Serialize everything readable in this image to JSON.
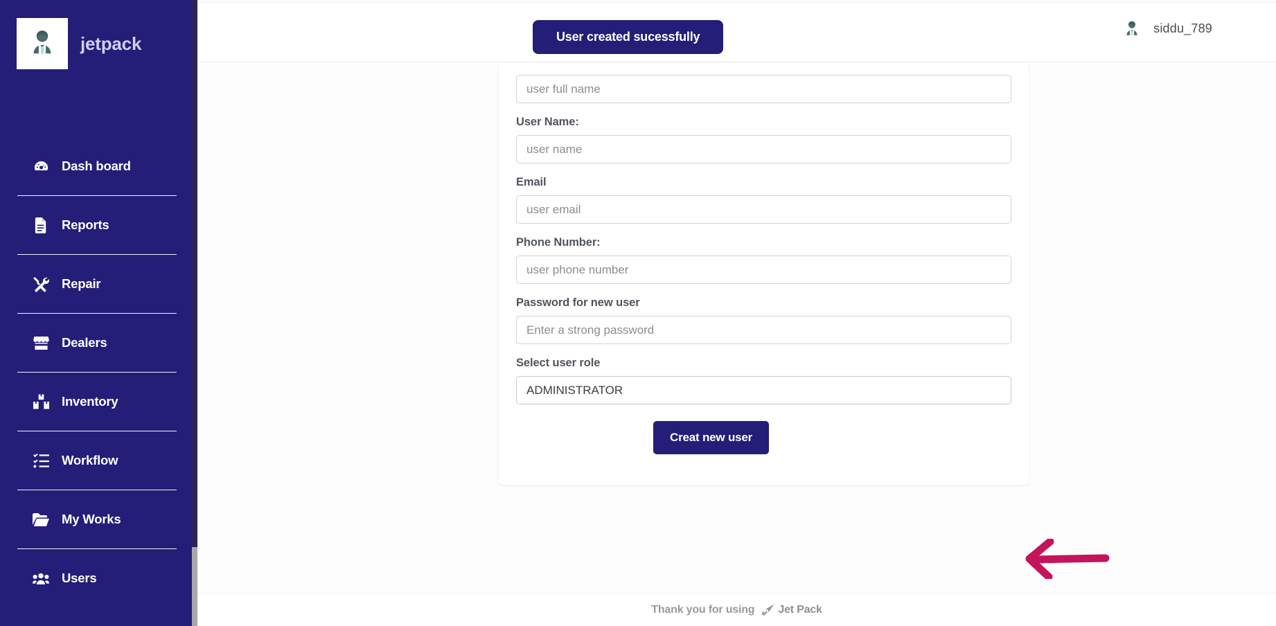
{
  "brand": {
    "name": "jetpack",
    "logo_icon": "user-avatar-icon"
  },
  "sidebar": {
    "items": [
      {
        "label": "Dash board",
        "icon": "dashboard-gauge-icon"
      },
      {
        "label": "Reports",
        "icon": "document-icon"
      },
      {
        "label": "Repair",
        "icon": "tools-wrench-screwdriver-icon"
      },
      {
        "label": "Dealers",
        "icon": "storefront-icon"
      },
      {
        "label": "Inventory",
        "icon": "boxes-icon"
      },
      {
        "label": "Workflow",
        "icon": "checklist-icon"
      },
      {
        "label": "My Works",
        "icon": "folder-open-icon"
      },
      {
        "label": "Users",
        "icon": "users-group-icon"
      }
    ]
  },
  "topbar": {
    "toast_message": "User created sucessfully",
    "user_name": "siddu_789",
    "avatar_icon": "user-avatar-icon"
  },
  "form": {
    "fields": [
      {
        "label": "",
        "placeholder": "user full name",
        "type": "text"
      },
      {
        "label": "User Name:",
        "placeholder": "user name",
        "type": "text"
      },
      {
        "label": "Email",
        "placeholder": "user email",
        "type": "text"
      },
      {
        "label": "Phone Number:",
        "placeholder": "user phone number",
        "type": "text"
      },
      {
        "label": "Password for new user",
        "placeholder": "Enter a strong password",
        "type": "password"
      }
    ],
    "role": {
      "label": "Select user role",
      "selected": "ADMINISTRATOR",
      "options": [
        "ADMINISTRATOR"
      ]
    },
    "submit_label": "Creat new user"
  },
  "annotation": {
    "arrow_icon": "left-arrow-annotation",
    "arrow_color": "#c4145c"
  },
  "footer": {
    "thanks_text": "Thank you for using",
    "brand_text": "Jet Pack",
    "icon": "jet-plane-icon"
  },
  "colors": {
    "brand_navy": "#241e78",
    "sidebar_edge": "#2d2356",
    "accent_crimson": "#c4145c",
    "page_bg": "#ffffff"
  }
}
